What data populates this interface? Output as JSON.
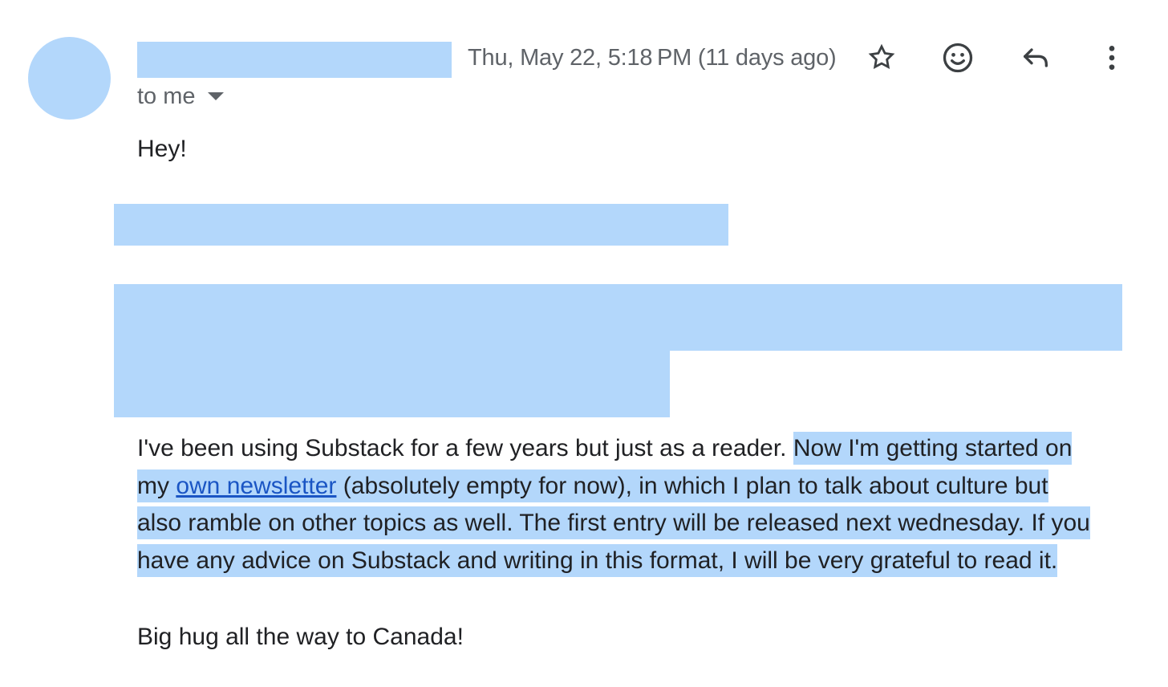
{
  "colors": {
    "redaction": "#b3d7fb",
    "text": "#202124",
    "secondary_text": "#5f6368",
    "link": "#1a55c4",
    "icon": "#3c4043"
  },
  "header": {
    "date": "Thu, May 22, 5:18 PM (11 days ago)",
    "recipient_label": "to me",
    "icons": {
      "star": "star-icon",
      "emoji": "emoji-icon",
      "reply": "reply-icon",
      "more": "more-vert-icon"
    }
  },
  "body": {
    "greeting": "Hey!",
    "paragraph": {
      "l1_plain": "I've been using Substack for a few years but just as a reader. ",
      "l1_sel": "Now I'm getting started on",
      "l2_pre": "my ",
      "l2_link": "own newsletter",
      "l2_post": " (absolutely empty for now), in which I plan to talk about culture but",
      "l3": "also ramble on other topics as well. The first entry will be released next wednesday. If you",
      "l4": "have any advice on Substack and writing in this format, I will be very grateful to read it."
    },
    "signoff": "Big hug all the way to Canada!"
  }
}
